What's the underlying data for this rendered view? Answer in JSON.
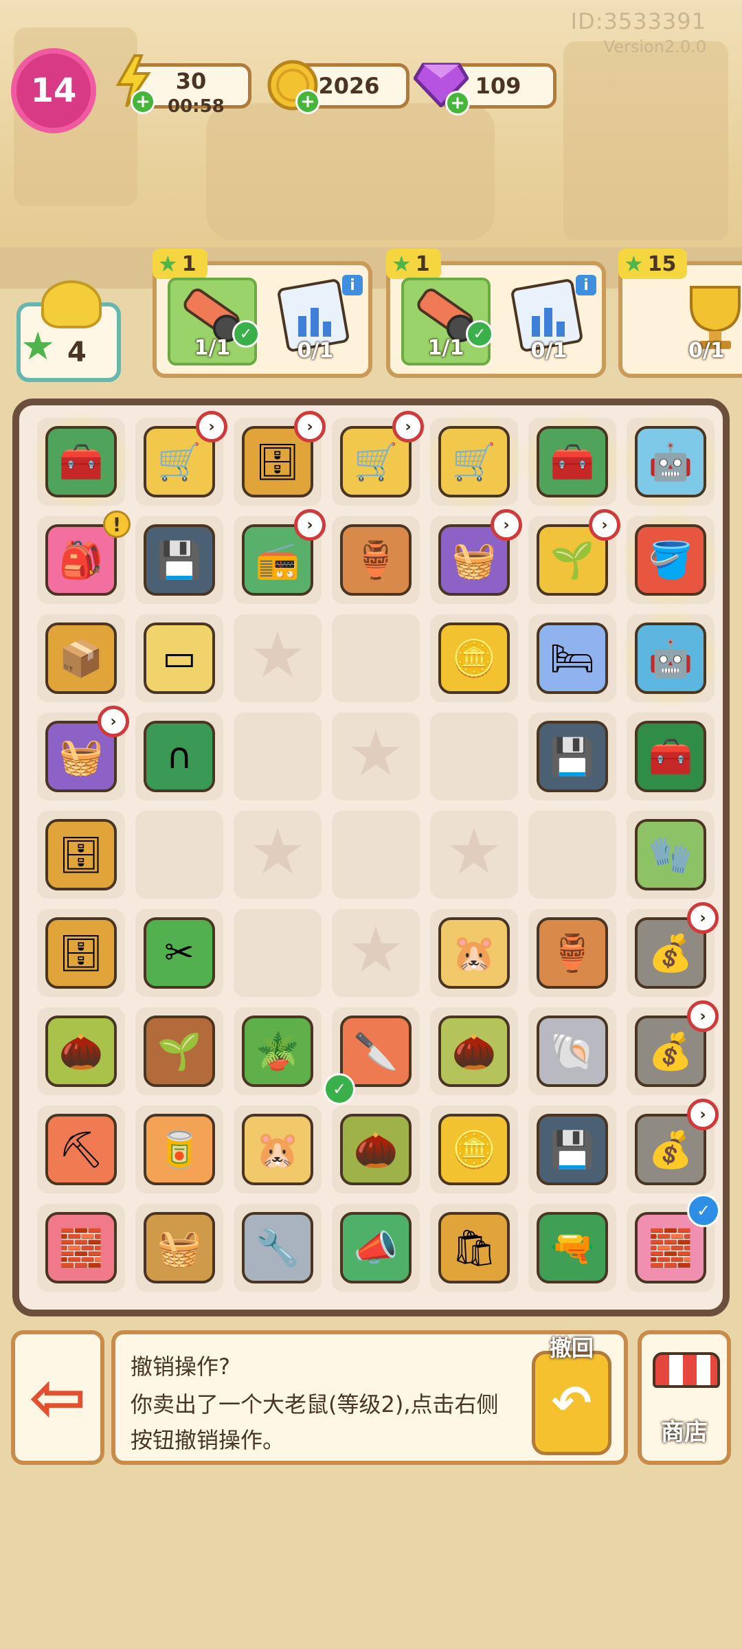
{
  "meta": {
    "user_id": "ID:3533391",
    "version": "Version2.0.0"
  },
  "header": {
    "level": "14",
    "energy": {
      "value": "30",
      "timer": "00:58",
      "icon": "lightning-icon"
    },
    "coins": {
      "value": "2026",
      "icon": "coin-icon"
    },
    "gems": {
      "value": "109",
      "icon": "gem-icon"
    }
  },
  "player": {
    "stars": "4"
  },
  "orders": [
    {
      "reward": "1",
      "items": [
        {
          "name": "box-cutter",
          "count": "1/1",
          "done": true
        },
        {
          "name": "report-chart",
          "count": "0/1",
          "done": false
        }
      ]
    },
    {
      "reward": "1",
      "items": [
        {
          "name": "box-cutter",
          "count": "1/1",
          "done": true
        },
        {
          "name": "report-chart",
          "count": "0/1",
          "done": false
        }
      ]
    },
    {
      "reward": "15",
      "items": [
        {
          "name": "trophy",
          "count": "0/1",
          "done": false
        }
      ]
    }
  ],
  "board": {
    "rows": [
      [
        {
          "name": "green-toolbox",
          "icon": "🧰",
          "color": "#4fa35a",
          "glow": true
        },
        {
          "name": "shopping-cart-full",
          "icon": "🛒",
          "color": "#f1c84b",
          "chain": true
        },
        {
          "name": "wooden-cabinet",
          "icon": "🗄",
          "color": "#e0a43a",
          "chain": true
        },
        {
          "name": "shopping-cart",
          "icon": "🛒",
          "color": "#f1c84b",
          "chain": true
        },
        {
          "name": "shopping-cart-blue",
          "icon": "🛒",
          "color": "#f1c84b",
          "glow": true
        },
        {
          "name": "green-toolbox-open",
          "icon": "🧰",
          "color": "#4fa35a",
          "glow": true
        },
        {
          "name": "robot-vacuum",
          "icon": "🤖",
          "color": "#7ec8e8",
          "glow": true
        }
      ],
      [
        {
          "name": "pink-backpack",
          "icon": "🎒",
          "color": "#f26f9f",
          "alert": true
        },
        {
          "name": "cpu-chip",
          "icon": "💾",
          "color": "#4b6173"
        },
        {
          "name": "radio",
          "icon": "📻",
          "color": "#58b06a",
          "chain": true
        },
        {
          "name": "clay-pot",
          "icon": "🏺",
          "color": "#d98a4a"
        },
        {
          "name": "junk-basket",
          "icon": "🧺",
          "color": "#8c62c7",
          "chain": true
        },
        {
          "name": "sprout-pot",
          "icon": "🌱",
          "color": "#f0c33b",
          "chain": true
        },
        {
          "name": "paint-bucket",
          "icon": "🪣",
          "color": "#e9563f",
          "glow": true
        }
      ],
      [
        {
          "name": "cardboard-box",
          "icon": "📦",
          "color": "#e0a43a"
        },
        {
          "name": "empty-tray",
          "icon": "▭",
          "color": "#f0d36a"
        },
        {
          "empty": true,
          "star": true
        },
        {
          "empty": true
        },
        {
          "name": "gold-coin",
          "icon": "🪙",
          "color": "#f2c230"
        },
        {
          "name": "blue-pillow",
          "icon": "🛏",
          "color": "#8fb3ee"
        },
        {
          "name": "robot-vacuum-blue",
          "icon": "🤖",
          "color": "#5db6e0",
          "glow": true
        }
      ],
      [
        {
          "name": "junk-basket-2",
          "icon": "🧺",
          "color": "#8c62c7",
          "chain": true
        },
        {
          "name": "green-handle",
          "icon": "∩",
          "color": "#3a9a55"
        },
        {
          "empty": true
        },
        {
          "empty": true,
          "star": true
        },
        {
          "empty": true
        },
        {
          "name": "cpu-chip-2",
          "icon": "💾",
          "color": "#4b6173"
        },
        {
          "name": "green-toolbox-closed",
          "icon": "🧰",
          "color": "#2f8d47"
        }
      ],
      [
        {
          "name": "small-drawer",
          "icon": "🗄",
          "color": "#e0a43a"
        },
        {
          "empty": true
        },
        {
          "empty": true,
          "star": true
        },
        {
          "empty": true
        },
        {
          "empty": true,
          "star": true
        },
        {
          "empty": true
        },
        {
          "name": "work-glove",
          "icon": "🧤",
          "color": "#8ec266"
        }
      ],
      [
        {
          "name": "drawer-cabinet",
          "icon": "🗄",
          "color": "#e0a43a"
        },
        {
          "name": "pruning-shears",
          "icon": "✂",
          "color": "#52b04e"
        },
        {
          "empty": true
        },
        {
          "empty": true,
          "star": true
        },
        {
          "name": "hamsters",
          "icon": "🐹",
          "color": "#f1c86a"
        },
        {
          "name": "broken-pot",
          "icon": "🏺",
          "color": "#d98a4a"
        },
        {
          "name": "money-sack",
          "icon": "💰",
          "color": "#8f8a82",
          "chain": true
        }
      ],
      [
        {
          "name": "seed-bag",
          "icon": "🌰",
          "color": "#a9c24a"
        },
        {
          "name": "seedling",
          "icon": "🌱",
          "color": "#b46b3c"
        },
        {
          "name": "potted-tree",
          "icon": "🪴",
          "color": "#5fb04b"
        },
        {
          "name": "box-cutter",
          "icon": "🔪",
          "color": "#ee7a52",
          "tick": true
        },
        {
          "name": "seed-bag-flat",
          "icon": "🌰",
          "color": "#b4c45a"
        },
        {
          "name": "snail-shell",
          "icon": "🐚",
          "color": "#b9b9c2"
        },
        {
          "name": "money-sack-2",
          "icon": "💰",
          "color": "#8f8a82",
          "chain": true
        }
      ],
      [
        {
          "name": "pickaxe",
          "icon": "⛏",
          "color": "#f07b52"
        },
        {
          "name": "paint-can",
          "icon": "🥫",
          "color": "#f4a254"
        },
        {
          "name": "hamster-family",
          "icon": "🐹",
          "color": "#f1c86a"
        },
        {
          "name": "seed-bags-stack",
          "icon": "🌰",
          "color": "#9fb24a"
        },
        {
          "name": "coin-pile",
          "icon": "🪙",
          "color": "#f2c230"
        },
        {
          "name": "cpu-chip-3",
          "icon": "💾",
          "color": "#4b6173"
        },
        {
          "name": "money-sack-3",
          "icon": "💰",
          "color": "#8f8a82",
          "chain": true
        }
      ],
      [
        {
          "name": "dirt-crate",
          "icon": "🧱",
          "color": "#f07a8a"
        },
        {
          "name": "wicker-basket",
          "icon": "🧺",
          "color": "#cf9a4a"
        },
        {
          "name": "hand-strengthener",
          "icon": "🔧",
          "color": "#a9b3c0"
        },
        {
          "name": "megaphone",
          "icon": "📣",
          "color": "#4fb06a"
        },
        {
          "name": "paper-bag",
          "icon": "🛍",
          "color": "#e0a43a"
        },
        {
          "name": "power-drill",
          "icon": "🔫",
          "color": "#3f9f55"
        },
        {
          "name": "brick-pile",
          "icon": "🧱",
          "color": "#f08fb0",
          "blue_tick": true
        }
      ]
    ]
  },
  "bottom": {
    "exit_icon": "exit-arrow-icon",
    "message_title": "撤销操作?",
    "message_body": "你卖出了一个大老鼠(等级2),点击右侧按钮撤销操作。",
    "undo_label": "撤回",
    "shop_label": "商店"
  },
  "colors": {
    "board_border": "#6b4f3c",
    "accent_pink": "#d83a86",
    "order_green": "#9ad36a"
  }
}
